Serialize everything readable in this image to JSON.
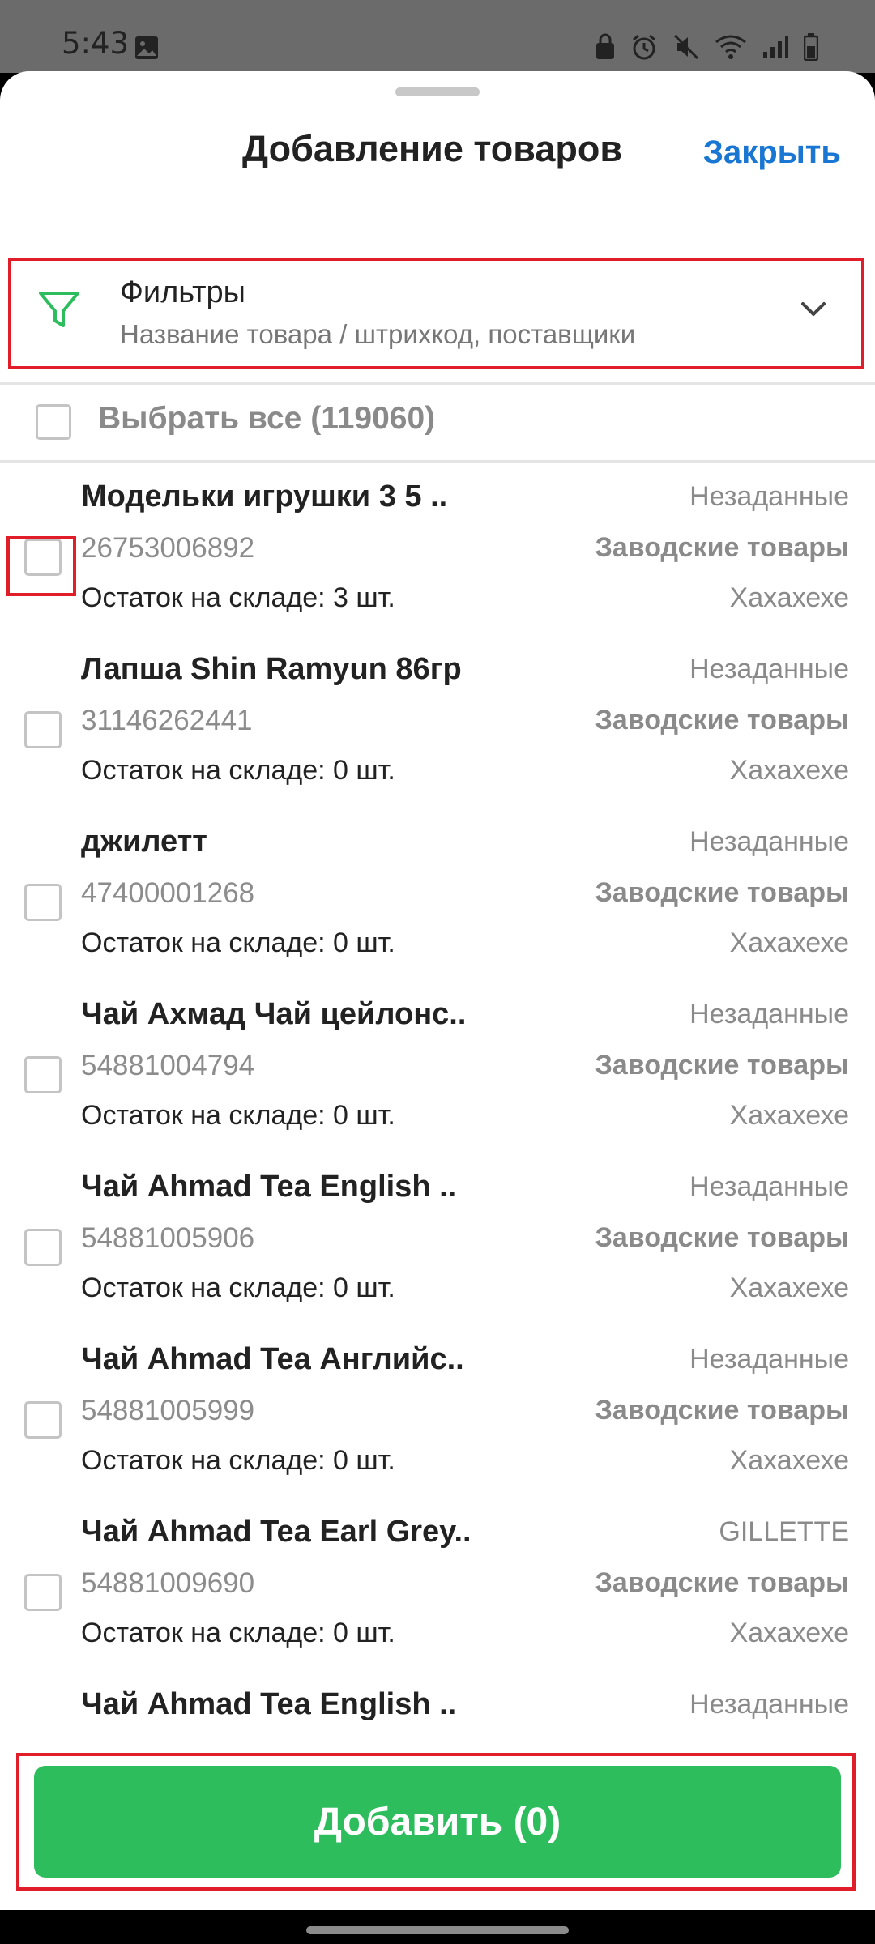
{
  "status_bar": {
    "time": "5:43",
    "icons": [
      "gallery-icon",
      "lock-icon",
      "alarm-icon",
      "mute-icon",
      "wifi-icon",
      "signal-icon",
      "battery-icon"
    ]
  },
  "sheet": {
    "title": "Добавление товаров",
    "close_label": "Закрыть"
  },
  "filters": {
    "title": "Фильтры",
    "subtitle": "Название товара / штрихкод, поставщики",
    "accent_color": "#2dbd5d"
  },
  "select_all": {
    "label": "Выбрать все (119060)"
  },
  "items": [
    {
      "name": "Модельки игрушки 3 5 ..",
      "barcode": "26753006892",
      "stock": "Остаток на складе: 3 шт.",
      "tag1": "Незаданные",
      "tag2": "Заводские товары",
      "tag3": "Хахахехе"
    },
    {
      "name": "Лапша Shin Ramyun 86гр",
      "barcode": "31146262441",
      "stock": "Остаток на складе: 0 шт.",
      "tag1": "Незаданные",
      "tag2": "Заводские товары",
      "tag3": "Хахахехе"
    },
    {
      "name": "джилетт",
      "barcode": "47400001268",
      "stock": "Остаток на складе: 0 шт.",
      "tag1": "Незаданные",
      "tag2": "Заводские товары",
      "tag3": "Хахахехе"
    },
    {
      "name": "Чай Ахмад Чай цейлонс..",
      "barcode": "54881004794",
      "stock": "Остаток на складе: 0 шт.",
      "tag1": "Незаданные",
      "tag2": "Заводские товары",
      "tag3": "Хахахехе"
    },
    {
      "name": "Чай Ahmad Tea English ..",
      "barcode": "54881005906",
      "stock": "Остаток на складе: 0 шт.",
      "tag1": "Незаданные",
      "tag2": "Заводские товары",
      "tag3": "Хахахехе"
    },
    {
      "name": "Чай Ahmad Tea Английс..",
      "barcode": "54881005999",
      "stock": "Остаток на складе: 0 шт.",
      "tag1": "Незаданные",
      "tag2": "Заводские товары",
      "tag3": "Хахахехе"
    },
    {
      "name": "Чай Ahmad Tea Earl Grey..",
      "barcode": "54881009690",
      "stock": "Остаток на складе: 0 шт.",
      "tag1": "GILLETTE",
      "tag2": "Заводские товары",
      "tag3": "Хахахехе"
    },
    {
      "name": "Чай Ahmad Tea English ..",
      "tag1": "Незаданные"
    }
  ],
  "add_button": {
    "label": "Добавить (0)",
    "color": "#2dbd5d"
  },
  "highlight_color": "#e11d2a"
}
